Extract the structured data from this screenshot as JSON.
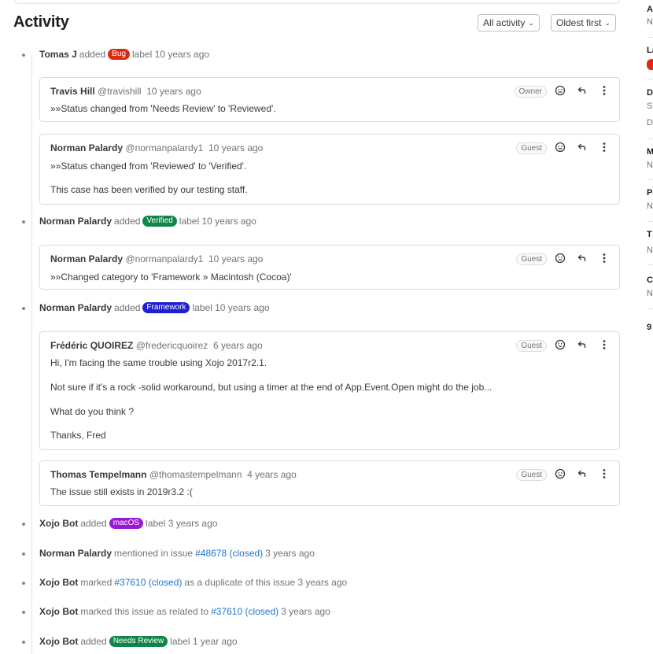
{
  "activity": {
    "title": "Activity",
    "filter_label": "All activity",
    "sort_label": "Oldest first"
  },
  "events": [
    {
      "author": "Tomas J",
      "verb": "added",
      "label": "Bug",
      "label_color": "#dd2b0e",
      "suffix": "label 10 years ago"
    },
    {
      "author": "Norman Palardy",
      "verb": "added",
      "label": "Verified",
      "label_color": "#108548",
      "suffix": "label 10 years ago"
    },
    {
      "author": "Norman Palardy",
      "verb": "added",
      "label": "Framework",
      "label_color": "#1f1fd2",
      "suffix": "label 10 years ago"
    },
    {
      "author": "Xojo Bot",
      "verb": "added",
      "label": "macOS",
      "label_color": "#9a18d6",
      "suffix": "label 3 years ago"
    },
    {
      "author": "Norman Palardy",
      "pre": "mentioned in issue",
      "link": "#48678 (closed)",
      "post": "3 years ago"
    },
    {
      "author": "Xojo Bot",
      "pre": "marked",
      "link": "#37610 (closed)",
      "post": "as a duplicate of this issue 3 years ago"
    },
    {
      "author": "Xojo Bot",
      "pre": "marked this issue as related to",
      "link": "#37610 (closed)",
      "post": "3 years ago"
    },
    {
      "author": "Xojo Bot",
      "verb": "added",
      "label": "Needs Review",
      "label_color": "#108548",
      "suffix": "label 1 year ago"
    }
  ],
  "notes": [
    {
      "name": "Travis Hill",
      "handle": "@travishill",
      "time": "10 years ago",
      "role": "Owner",
      "lines": [
        "»»Status changed from 'Needs Review' to 'Reviewed'."
      ]
    },
    {
      "name": "Norman Palardy",
      "handle": "@normanpalardy1",
      "time": "10 years ago",
      "role": "Guest",
      "lines": [
        "»»Status changed from 'Reviewed' to 'Verified'.",
        "This case has been verified by our testing staff."
      ]
    },
    {
      "name": "Norman Palardy",
      "handle": "@normanpalardy1",
      "time": "10 years ago",
      "role": "Guest",
      "lines": [
        "»»Changed category to 'Framework » Macintosh (Cocoa)'"
      ]
    },
    {
      "name": "Frédéric QUOIREZ",
      "handle": "@fredericquoirez",
      "time": "6 years ago",
      "role": "Guest",
      "lines": [
        "Hi, I'm facing the same trouble using Xojo 2017r2.1.",
        "Not sure if it's a rock -solid workaround, but using a timer at the end of App.Event.Open might do the job...",
        "What do you think ?",
        "Thanks, Fred"
      ]
    },
    {
      "name": "Thomas Tempelmann",
      "handle": "@thomastempelmann",
      "time": "4 years ago",
      "role": "Guest",
      "lines": [
        "The issue still exists in 2019r3.2 :("
      ]
    }
  ],
  "sidebar": {
    "items": [
      {
        "head": "A",
        "val": "N"
      },
      {
        "head": "La",
        "val": ""
      },
      {
        "head": "D",
        "val": "S"
      },
      {
        "head": "",
        "val": "D"
      },
      {
        "head": "M",
        "val": "N"
      },
      {
        "head": "Pa",
        "val": "N"
      },
      {
        "head": "T",
        "val": "N"
      },
      {
        "head": "C",
        "val": "N"
      },
      {
        "head": "9",
        "val": ""
      }
    ]
  }
}
